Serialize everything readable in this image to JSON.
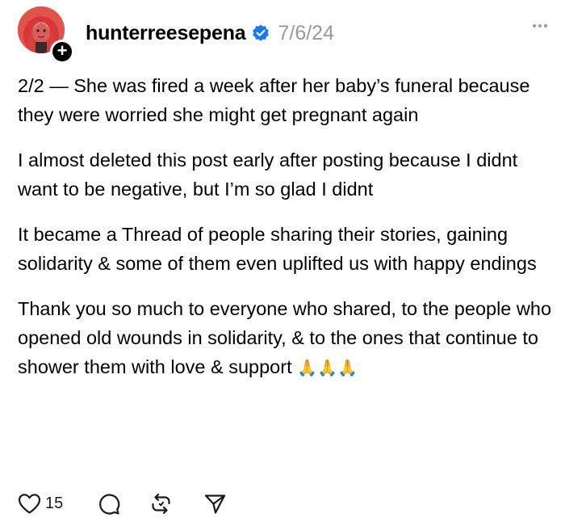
{
  "post": {
    "username": "hunterreesepena",
    "date": "7/6/24",
    "follow_symbol": "+",
    "verified_icon": "verified-badge-icon",
    "verified_color": "#1877f2",
    "paragraphs": [
      "2/2 — She was fired a week after her baby’s funeral because they were worried she might get pregnant again",
      "I almost deleted this post early after posting because I didnt want to be negative, but I’m so glad I didnt",
      "It became a Thread of people sharing their stories, gaining solidarity & some of them even uplifted us with happy endings",
      "Thank you so much to everyone who shared, to the people who opened old wounds in solidarity, & to the ones that continue to shower them with love & support"
    ],
    "emoji": "🙏🙏🙏"
  },
  "actions": {
    "like_count": "15",
    "icons": [
      "heart-icon",
      "comment-icon",
      "repost-icon",
      "share-icon"
    ]
  }
}
